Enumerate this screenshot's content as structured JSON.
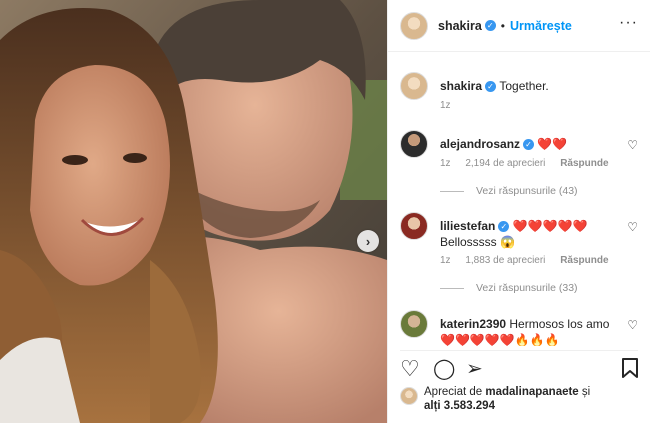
{
  "header": {
    "username": "shakira",
    "separator": "•",
    "follow_label": "Urmărește",
    "more_label": "···"
  },
  "caption": {
    "username": "shakira",
    "text": "Together.",
    "time": "1z"
  },
  "comments": [
    {
      "username": "alejandrosanz",
      "text": "❤️❤️",
      "time": "1z",
      "likes": "2,194 de aprecieri",
      "reply_label": "Răspunde",
      "view_replies": "Vezi răspunsurile (43)"
    },
    {
      "username": "liliestefan",
      "text": "❤️❤️❤️❤️❤️",
      "text2": "Bellosssss 😱",
      "time": "1z",
      "likes": "1,883 de aprecieri",
      "reply_label": "Răspunde",
      "view_replies": "Vezi răspunsurile (33)"
    },
    {
      "username": "katerin2390",
      "text": "Hermosos los amo",
      "text2": "❤️❤️❤️❤️❤️🔥🔥🔥"
    }
  ],
  "likes": {
    "prefix": "Apreciat de",
    "liker": "madalinapanaete",
    "suffix": "și",
    "others": "alți 3.583.294"
  },
  "icons": {
    "heart": "♡",
    "comment": "◯",
    "share": "➢",
    "bookmark": "bookmark-icon",
    "next": "›",
    "verified": "✓"
  },
  "colors": {
    "follow": "#0095f6",
    "verified": "#3897f0",
    "heart": "#ed2d3c"
  }
}
